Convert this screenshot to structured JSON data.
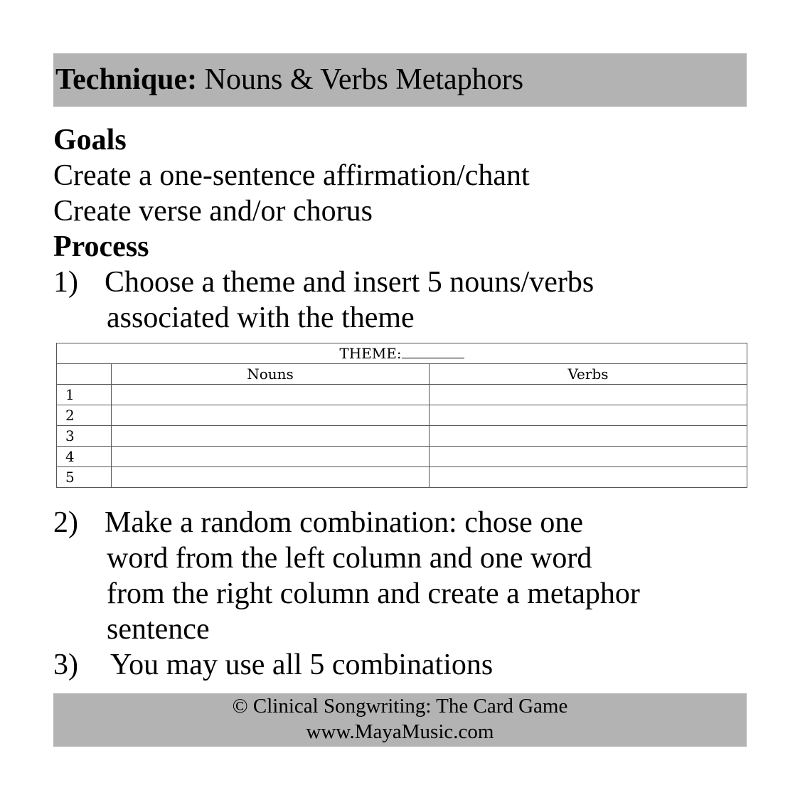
{
  "header": {
    "label": "Technique:",
    "title": "Nouns & Verbs Metaphors"
  },
  "goals": {
    "heading": "Goals",
    "items": [
      "Create a one-sentence affirmation/chant",
      "Create verse and/or chorus"
    ]
  },
  "process": {
    "heading": "Process",
    "steps": [
      {
        "number": "1)",
        "lines": [
          "Choose a theme and insert 5 nouns/verbs",
          "associated with the theme"
        ]
      },
      {
        "number": "2)",
        "lines": [
          "Make a random combination: chose one",
          "word from the left column and one word",
          "from the right column and create a metaphor",
          "sentence"
        ]
      },
      {
        "number": "3)",
        "lines": [
          "You may use all 5 combinations"
        ]
      }
    ]
  },
  "table": {
    "theme_label": "THEME:",
    "columns": [
      "",
      "Nouns",
      "Verbs"
    ],
    "rows": [
      [
        "1",
        "",
        ""
      ],
      [
        "2",
        "",
        ""
      ],
      [
        "3",
        "",
        ""
      ],
      [
        "4",
        "",
        ""
      ],
      [
        "5",
        "",
        ""
      ]
    ]
  },
  "footer": {
    "line1": "© Clinical Songwriting: The Card Game",
    "line2": "www.MayaMusic.com"
  },
  "colors": {
    "bar_background": "#b3b3b3",
    "text": "#000000",
    "grid_border": "#555555"
  }
}
